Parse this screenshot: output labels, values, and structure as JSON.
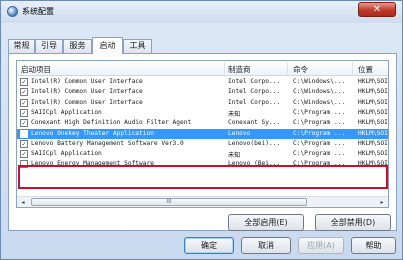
{
  "window": {
    "title": "系统配置",
    "close_glyph": "✕"
  },
  "tabs": [
    {
      "label": "常规",
      "active": false
    },
    {
      "label": "引导",
      "active": false
    },
    {
      "label": "服务",
      "active": false
    },
    {
      "label": "启动",
      "active": true
    },
    {
      "label": "工具",
      "active": false
    }
  ],
  "columns": {
    "item": "启动项目",
    "manufacturer": "制造商",
    "command": "命令",
    "location": "位置"
  },
  "rows": [
    {
      "checked": true,
      "item": "Intel(R) Common User Interface",
      "manufacturer": "Intel Corpo...",
      "command": "C:\\Windows\\...",
      "location": "HKLM\\SOI"
    },
    {
      "checked": true,
      "item": "Intel(R) Common User Interface",
      "manufacturer": "Intel Corpo...",
      "command": "C:\\Windows\\...",
      "location": "HKLM\\SOI"
    },
    {
      "checked": true,
      "item": "Intel(R) Common User Interface",
      "manufacturer": "Intel Corpo...",
      "command": "C:\\Windows\\...",
      "location": "HKLM\\SOI"
    },
    {
      "checked": true,
      "item": "SAIICpl Application",
      "manufacturer": "未知",
      "command": "C:\\Program ...",
      "location": "HKLM\\SOI"
    },
    {
      "checked": true,
      "item": "Conexant High Definition Audio Filter Agent",
      "manufacturer": "Conexant Sy...",
      "command": "C:\\Program ...",
      "location": "HKLM\\SOI"
    },
    {
      "checked": false,
      "item": "Lenovo Onekey Theater Application",
      "manufacturer": "Lenovo",
      "command": "C:\\Program ...",
      "location": "HKLM\\SOI",
      "selected": true
    },
    {
      "checked": true,
      "item": "Lenovo Battery Management Software Ver3.0",
      "manufacturer": "Lenovo(bei)...",
      "command": "C:\\Program ...",
      "location": "HKLM\\SOI"
    },
    {
      "checked": true,
      "item": "SAIICpl Application",
      "manufacturer": "未知",
      "command": "C:\\Program ...",
      "location": "HKLM\\SOI"
    },
    {
      "checked": false,
      "item": "Lenovo Energy Management Software",
      "manufacturer": "Lenovo (Bei...",
      "command": "C:\\Program ...",
      "location": "HKLM\\SOI"
    }
  ],
  "scrollbar": {
    "left_arrow": "◂",
    "right_arrow": "▸",
    "thumb_grip": "III"
  },
  "actions": {
    "enable_all": "全部启用(E)",
    "disable_all": "全部禁用(D)"
  },
  "footer": {
    "ok": "确定",
    "cancel": "取消",
    "apply": "应用(A)",
    "help": "帮助"
  },
  "colors": {
    "selection": "#3399ff",
    "highlight_border": "#c8102e"
  }
}
